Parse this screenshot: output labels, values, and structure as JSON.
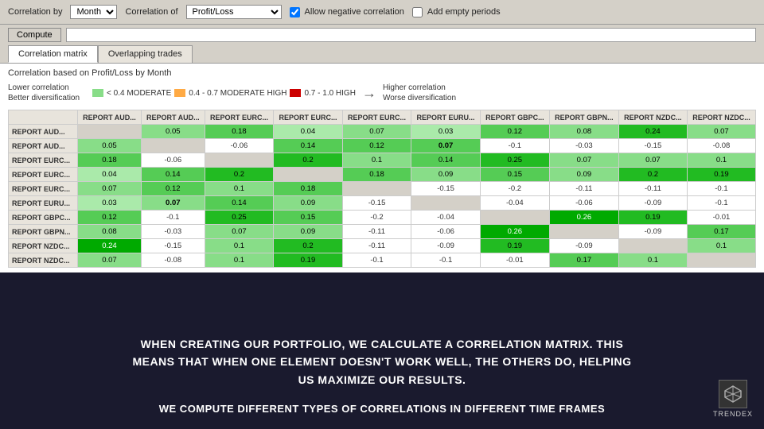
{
  "toolbar": {
    "correlation_by_label": "Correlation by",
    "correlation_by_value": "Month",
    "correlation_of_label": "Correlation of",
    "correlation_of_value": "Profit/Loss",
    "allow_negative_label": "Allow negative correlation",
    "add_empty_label": "Add empty periods",
    "compute_label": "Compute"
  },
  "tabs": [
    {
      "label": "Correlation matrix",
      "active": true
    },
    {
      "label": "Overlapping trades",
      "active": false
    }
  ],
  "content": {
    "subtitle": "Correlation based on Profit/Loss by Month",
    "legend": {
      "lower_label": "Lower correlation",
      "better_label": "Better diversification",
      "moderate_label": "< 0.4 MODERATE",
      "mod_high_label": "0.4 - 0.7 MODERATE HIGH",
      "high_label": "0.7 - 1.0 HIGH",
      "higher_label": "Higher correlation",
      "worse_label": "Worse diversification"
    }
  },
  "matrix": {
    "headers": [
      "",
      "REPORT AUD...",
      "REPORT AUD...",
      "REPORT EURC...",
      "REPORT EURC...",
      "REPORT EURC...",
      "REPORT EURU...",
      "REPORT GBPC...",
      "REPORT GBPN...",
      "REPORT NZDC...",
      "REPORT NZDC..."
    ],
    "rows": [
      {
        "label": "REPORT AUD...",
        "cells": [
          "diag",
          "0.05",
          "0.18",
          "0.04",
          "0.07",
          "0.03",
          "0.12",
          "0.08",
          "0.24",
          "0.07"
        ]
      },
      {
        "label": "REPORT AUD...",
        "cells": [
          "0.05",
          "diag",
          "-0.06",
          "0.14",
          "0.12",
          "0.07*",
          "-0.1",
          "-0.03",
          "-0.15",
          "-0.08"
        ]
      },
      {
        "label": "REPORT EURC...",
        "cells": [
          "0.18",
          "-0.06",
          "diag",
          "0.2",
          "0.1",
          "0.14",
          "0.25",
          "0.07",
          "0.07",
          "0.1"
        ]
      },
      {
        "label": "REPORT EURC...",
        "cells": [
          "0.04",
          "0.14",
          "0.2",
          "diag",
          "0.18",
          "0.09",
          "0.15",
          "0.09",
          "0.2",
          "0.19"
        ]
      },
      {
        "label": "REPORT EURC...",
        "cells": [
          "0.07",
          "0.12",
          "0.1",
          "0.18",
          "diag",
          "-0.15",
          "-0.2",
          "-0.11",
          "-0.11",
          "-0.1"
        ]
      },
      {
        "label": "REPORT EURU...",
        "cells": [
          "0.03",
          "0.07*",
          "0.14",
          "0.09",
          "-0.15",
          "diag",
          "-0.04",
          "-0.06",
          "-0.09",
          "-0.1"
        ]
      },
      {
        "label": "REPORT GBPC...",
        "cells": [
          "0.12",
          "-0.1",
          "0.25",
          "0.15",
          "-0.2",
          "-0.04",
          "diag",
          "0.26",
          "0.19",
          "-0.01"
        ]
      },
      {
        "label": "REPORT GBPN...",
        "cells": [
          "0.08",
          "-0.03",
          "0.07",
          "0.09",
          "-0.11",
          "-0.06",
          "0.26",
          "diag",
          "-0.09",
          "0.17"
        ]
      },
      {
        "label": "REPORT NZDC...",
        "cells": [
          "0.24",
          "-0.15",
          "0.1",
          "0.2",
          "-0.11",
          "-0.09",
          "0.19",
          "-0.09",
          "diag",
          "0.1"
        ]
      },
      {
        "label": "REPORT NZDC...",
        "cells": [
          "0.07",
          "-0.08",
          "0.1",
          "0.19",
          "-0.1",
          "-0.1",
          "-0.01",
          "0.17",
          "0.1",
          "diag"
        ]
      }
    ]
  },
  "bottom": {
    "main_text": "WHEN CREATING OUR PORTFOLIO, WE CALCULATE A CORRELATION MATRIX. THIS\nMEANS THAT WHEN ONE ELEMENT DOESN'T WORK WELL, THE OTHERS DO, HELPING\nUS MAXIMIZE OUR RESULTS.",
    "sub_text": "WE COMPUTE DIFFERENT TYPES OF CORRELATIONS IN DIFFERENT TIME FRAMES",
    "logo_text": "TRENDEX"
  }
}
